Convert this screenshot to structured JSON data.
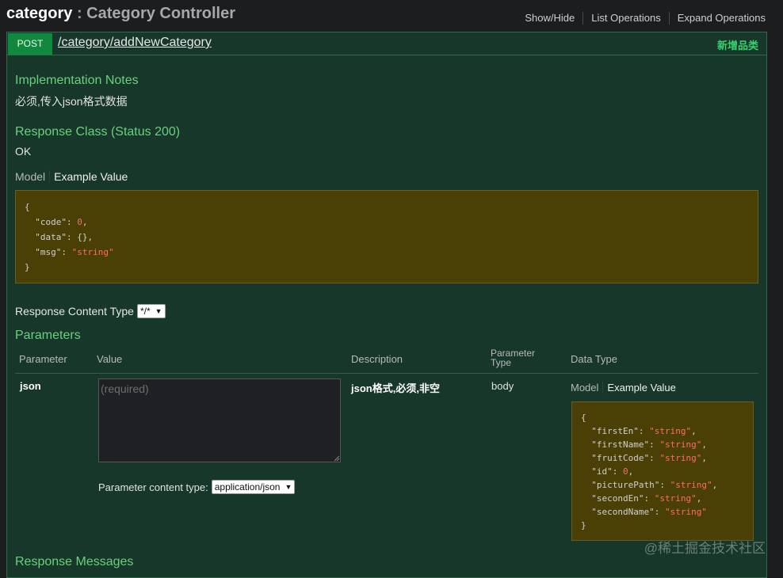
{
  "header": {
    "resource_name": "category",
    "separator": ":",
    "resource_desc": "Category Controller",
    "ops": [
      "Show/Hide",
      "List Operations",
      "Expand Operations"
    ]
  },
  "operation": {
    "method": "POST",
    "path": "/category/addNewCategory",
    "summary": "新增品类",
    "impl_notes_title": "Implementation Notes",
    "impl_notes": "必须,传入json格式数据",
    "response_class_title": "Response Class (Status 200)",
    "response_class": "OK",
    "model_tab": "Model",
    "example_tab": "Example Value",
    "response_example": [
      "{",
      "  \"code\": 0,",
      "  \"data\": {},",
      "  \"msg\": \"string\"",
      "}"
    ],
    "response_content_type_label": "Response Content Type",
    "response_content_type": "*/*",
    "parameters_title": "Parameters",
    "param_headers": {
      "parameter": "Parameter",
      "value": "Value",
      "description": "Description",
      "parameter_type_1": "Parameter",
      "parameter_type_2": "Type",
      "data_type": "Data Type"
    },
    "param": {
      "name": "json",
      "placeholder": "(required)",
      "description": "json格式,必须,非空",
      "type": "body",
      "content_type_label": "Parameter content type:",
      "content_type": "application/json",
      "model_tab": "Model",
      "example_tab": "Example Value",
      "example": [
        "{",
        "  \"firstEn\": \"string\",",
        "  \"firstName\": \"string\",",
        "  \"fruitCode\": \"string\",",
        "  \"id\": 0,",
        "  \"picturePath\": \"string\",",
        "  \"secondEn\": \"string\",",
        "  \"secondName\": \"string\"",
        "}"
      ]
    },
    "response_messages_title": "Response Messages"
  },
  "watermark": "@稀土掘金技术社区",
  "colors": {
    "method_post": "#10893e",
    "accent_green": "#6ad17b",
    "op_background": "#17372b",
    "code_background": "#4a3f05",
    "string_value": "#ff6b6b"
  }
}
